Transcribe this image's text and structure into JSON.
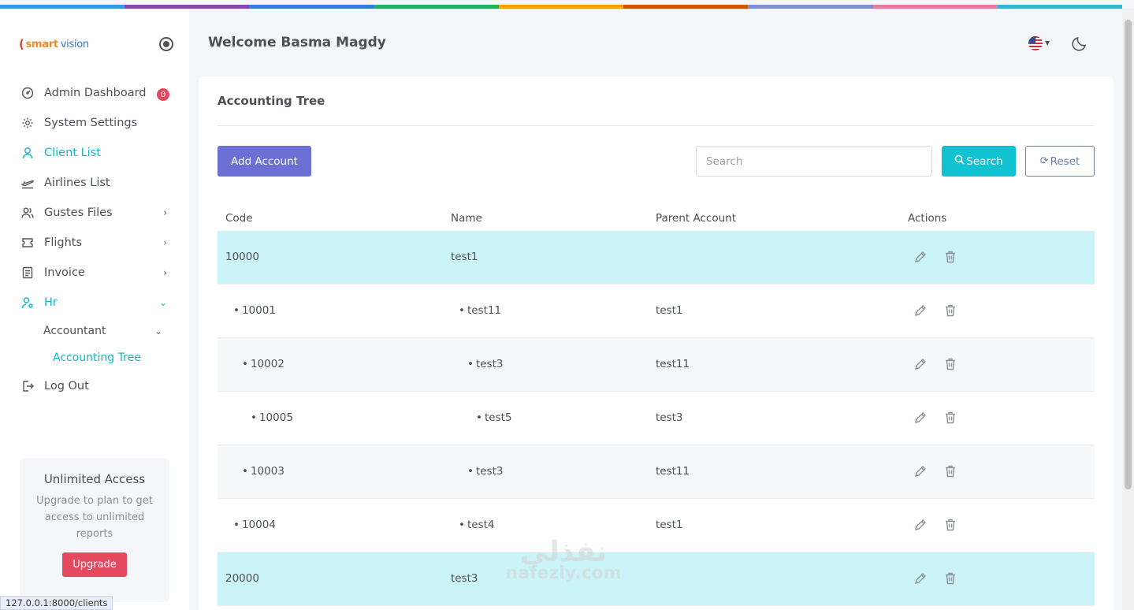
{
  "topbar_colors": [
    "#3a9ad9",
    "#8e44ad",
    "#3a7bd5",
    "#27ae60",
    "#f0a500",
    "#d35400",
    "#7f8cd6",
    "#e87aa0",
    "#3ab0d6"
  ],
  "sidebar": {
    "logo": {
      "mark": "(",
      "text_1": "smart",
      "text_2": "vision"
    },
    "items": [
      {
        "label": "Admin Dashboard",
        "icon": "dashboard-gauge-icon",
        "badge": "0"
      },
      {
        "label": "System Settings",
        "icon": "gear-icon"
      },
      {
        "label": "Client List",
        "icon": "user-icon"
      },
      {
        "label": "Airlines List",
        "icon": "airplane-icon"
      },
      {
        "label": "Gustes Files",
        "icon": "users-icon"
      },
      {
        "label": "Flights",
        "icon": "ticket-icon"
      },
      {
        "label": "Invoice",
        "icon": "document-icon"
      },
      {
        "label": "Hr",
        "icon": "user-settings-icon"
      }
    ],
    "sub": {
      "label": "Accountant"
    },
    "subsub": {
      "label": "Accounting Tree"
    },
    "logout": {
      "label": "Log Out",
      "icon": "logout-icon"
    },
    "upgrade_card": {
      "title": "Unlimited Access",
      "text": "Upgrade to plan to get access to unlimited reports",
      "button": "Upgrade"
    }
  },
  "header": {
    "welcome": "Welcome Basma Magdy",
    "language_icon": "us-flag-icon",
    "theme_icon": "moon-icon"
  },
  "page": {
    "title": "Accounting Tree",
    "add_button": "Add Account",
    "search_placeholder": "Search",
    "search_value": "",
    "search_button": "Search",
    "reset_button": "Reset"
  },
  "table": {
    "columns": [
      "Code",
      "Name",
      "Parent Account",
      "Actions"
    ],
    "rows": [
      {
        "code": "10000",
        "name": "test1",
        "parent": ""
      },
      {
        "code": "10001",
        "name": "test11",
        "parent": "test1"
      },
      {
        "code": "10002",
        "name": "test3",
        "parent": "test11"
      },
      {
        "code": "10005",
        "name": "test5",
        "parent": "test3"
      },
      {
        "code": "10003",
        "name": "test3",
        "parent": "test11"
      },
      {
        "code": "10004",
        "name": "test4",
        "parent": "test1"
      },
      {
        "code": "20000",
        "name": "test3",
        "parent": ""
      }
    ]
  },
  "status_url": "127.0.0.1:8000/clients",
  "watermark": {
    "line1": "نفذلي",
    "line2": "nafezly.com"
  }
}
